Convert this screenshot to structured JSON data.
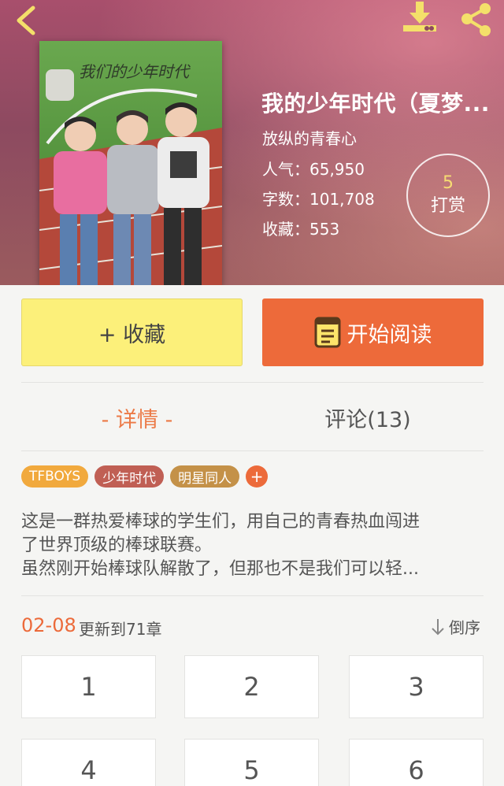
{
  "book": {
    "title": "我的少年时代（夏梦...",
    "subtitle": "放纵的青春心",
    "popularity": "人气：65,950",
    "word_count": "字数：101,708",
    "favorites": "收藏：553",
    "cover_title": "我们的少年时代"
  },
  "reward": {
    "count": "5",
    "label": "打赏"
  },
  "actions": {
    "favorite_label": "+ 收藏",
    "read_label": "开始阅读"
  },
  "tabs": {
    "details": "- 详情 -",
    "comments": "评论(13)"
  },
  "tags": [
    "TFBOYS",
    "少年时代",
    "明星同人"
  ],
  "tag_add": "+",
  "description": [
    "这是一群热爱棒球的学生们，用自己的青春热血闯进",
    "了世界顶级的棒球联赛。",
    "虽然刚开始棒球队解散了，但那也不是我们可以轻..."
  ],
  "chapters": {
    "update_date": "02-08",
    "update_text": "更新到71章",
    "sort_label": "倒序",
    "items": [
      "1",
      "2",
      "3",
      "4",
      "5",
      "6"
    ]
  },
  "colors": {
    "accent_orange": "#ed6a3a",
    "fav_yellow": "#fcf07a",
    "tag_tfboys": "#f1a93d",
    "tag_shaonian": "#c05f54",
    "tag_mingxing": "#c49148",
    "tag_add": "#ec6a3a"
  },
  "icons": {
    "back": "back-arrow-icon",
    "download": "download-icon",
    "share": "share-icon",
    "book": "book-icon",
    "sort": "sort-down-icon"
  }
}
